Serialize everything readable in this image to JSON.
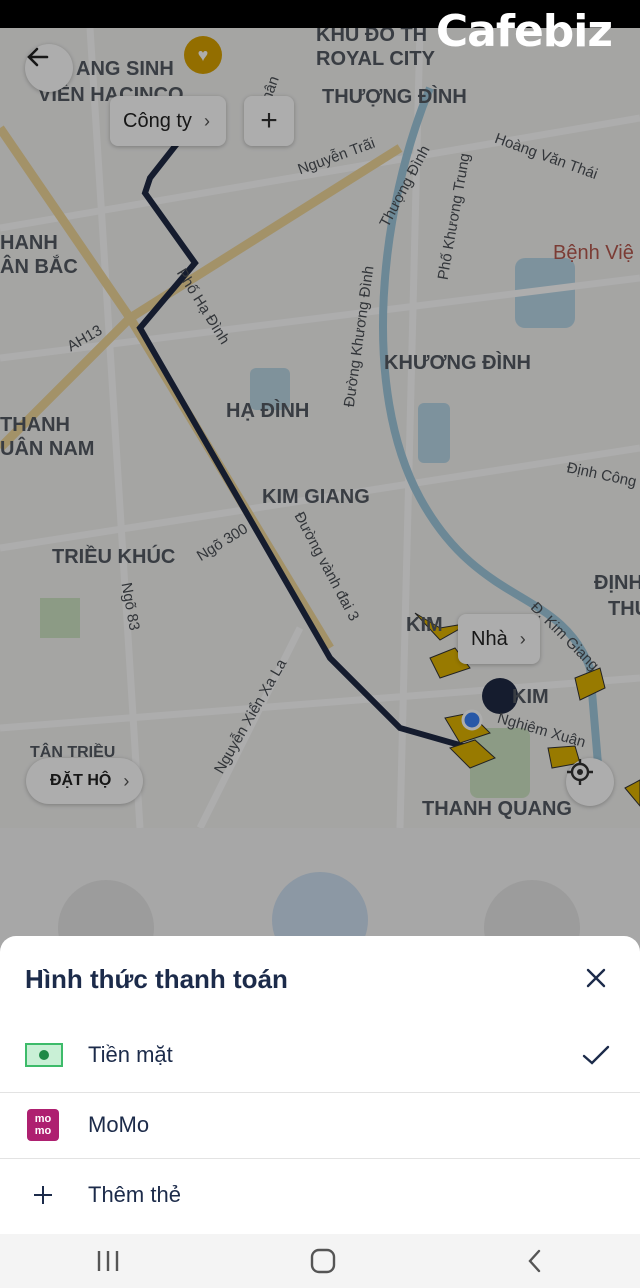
{
  "watermark": "Cafebiz",
  "map": {
    "areas": [
      "KHU ĐÔ TH",
      "ROYAL CITY",
      "ANG SINH",
      "VIÊN HACINCO",
      "THƯỢNG ĐÌNH",
      "HANH",
      "ÂN BẮC",
      "KHƯƠNG ĐÌNH",
      "THANH",
      "UÂN NAM",
      "HẠ ĐÌNH",
      "KIM GIANG",
      "TRIỀU KHÚC",
      "ĐỊNH",
      "THU",
      "KIM",
      "KIM",
      "TÂN TRIỀU",
      "THANH QUANG"
    ],
    "streets": [
      "Nguyễn Trãi",
      "Hoàng Văn Thái",
      "Thượng Đình",
      "Phố Khương Trung",
      "Phố Hạ Đình",
      "AH13",
      "Đường Khương Đình",
      "Ngõ 300",
      "Đường vành đai 3",
      "Ngõ 83",
      "Nguyễn Xiển Xa La",
      "Đ. Kim Giang",
      "Định Công H",
      "Nghiêm Xuân",
      "hân"
    ],
    "hospital": "Bệnh Việ",
    "work_chip": "Công ty",
    "home_chip": "Nhà",
    "book_for_other": "ĐẶT HỘ"
  },
  "sheet": {
    "title": "Hình thức thanh toán",
    "options": [
      {
        "label": "Tiền mặt",
        "icon": "cash-icon",
        "selected": true
      },
      {
        "label": "MoMo",
        "icon": "momo-icon",
        "badge": "mo mo"
      },
      {
        "label": "Thêm thẻ",
        "icon": "plus-icon"
      }
    ]
  },
  "colors": {
    "title": "#1c2b4a",
    "route": "#1f2a44",
    "bike_marker": "#e0b400",
    "momo": "#ae2070",
    "cash": "#3dbb6a"
  }
}
